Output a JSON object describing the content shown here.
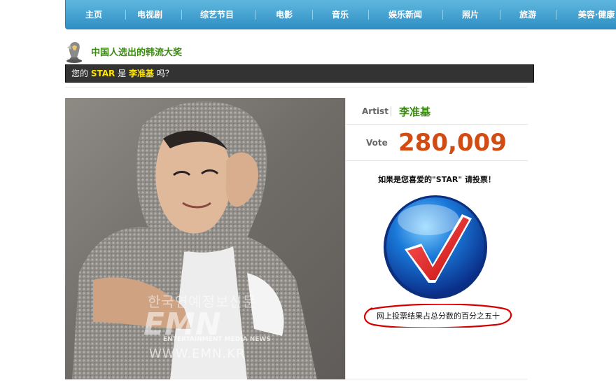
{
  "nav": {
    "items": [
      "主页",
      "电视剧",
      "综艺节目",
      "电影",
      "音乐",
      "娱乐新闻",
      "照片",
      "旅游",
      "美容·健康"
    ]
  },
  "section": {
    "title": "中国人选出的韩流大奖"
  },
  "question": {
    "prefix": "您的",
    "star": "STAR",
    "middle": "是",
    "name": "李准基",
    "suffix": "吗？"
  },
  "photo": {
    "watermark_korean": "한국연예정보신문",
    "watermark_logo": "EMN",
    "watermark_sub": "ENTERTAINMENT MEDIA NEWS",
    "watermark_url": "WWW.EMN.KR"
  },
  "panel": {
    "artist_label": "Artist",
    "artist_value": "李准基",
    "vote_label": "Vote",
    "vote_value": "280,009",
    "prompt": "如果是您喜爱的\"STAR\" 请投票！",
    "note": "网上投票结果占总分数的百分之五十"
  },
  "colors": {
    "nav": "#2f8fc4",
    "title_green": "#3a8a10",
    "vote_orange": "#d24b12",
    "highlight_yellow": "#ffe400"
  },
  "icons": {
    "section": "trophy-icon",
    "vote": "checkmark-vote-icon"
  }
}
